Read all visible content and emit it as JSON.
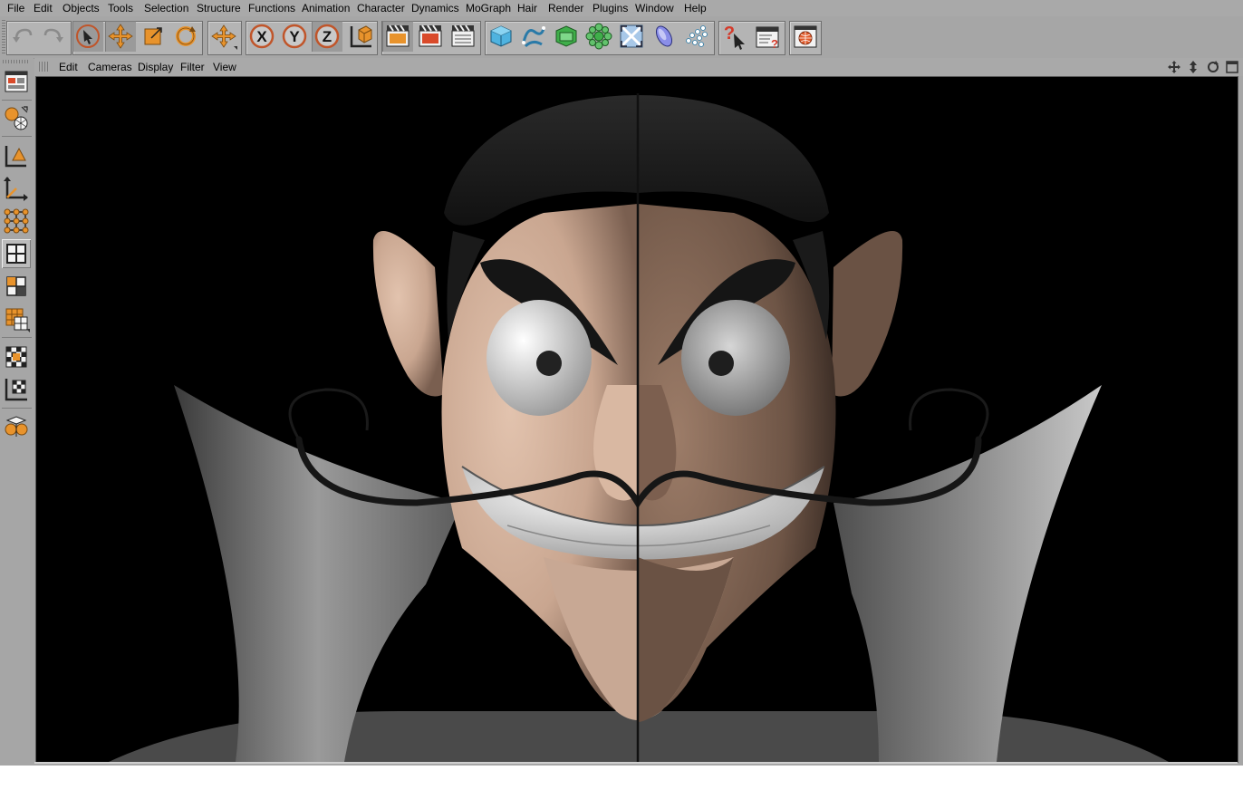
{
  "menu": [
    "File",
    "Edit",
    "Objects",
    "Tools",
    "Selection",
    "Structure",
    "Functions",
    "Animation",
    "Character",
    "Dynamics",
    "MoGraph",
    "Hair",
    "Render",
    "Plugins",
    "Window",
    "Help"
  ],
  "toolbar": {
    "buttons": [
      {
        "name": "undo-icon"
      },
      {
        "name": "redo-icon"
      },
      {
        "name": "live-selection-icon"
      },
      {
        "name": "move-icon"
      },
      {
        "name": "scale-icon"
      },
      {
        "name": "rotate-icon"
      },
      {
        "name": "recent-tool-icon"
      },
      {
        "name": "x-axis-icon",
        "glyph": "X"
      },
      {
        "name": "y-axis-icon",
        "glyph": "Y"
      },
      {
        "name": "z-axis-icon",
        "glyph": "Z"
      },
      {
        "name": "coordinate-system-icon"
      },
      {
        "name": "render-view-icon"
      },
      {
        "name": "render-picture-viewer-icon"
      },
      {
        "name": "render-settings-icon"
      },
      {
        "name": "cube-icon"
      },
      {
        "name": "spline-icon"
      },
      {
        "name": "nurbs-icon"
      },
      {
        "name": "array-icon"
      },
      {
        "name": "deformer-icon"
      },
      {
        "name": "scene-icon"
      },
      {
        "name": "particle-icon"
      },
      {
        "name": "help-icon"
      },
      {
        "name": "commander-icon"
      },
      {
        "name": "browser-icon"
      }
    ]
  },
  "left_palette": [
    {
      "name": "layout-icon"
    },
    {
      "name": "make-editable-icon"
    },
    {
      "name": "use-model-tool-icon"
    },
    {
      "name": "use-object-axis-icon"
    },
    {
      "name": "use-points-tool-icon"
    },
    {
      "name": "use-edges-tool-icon"
    },
    {
      "name": "use-polygons-tool-icon"
    },
    {
      "name": "use-uv-tool-icon"
    },
    {
      "name": "texture-tool-icon"
    },
    {
      "name": "workplane-icon"
    },
    {
      "name": "mirror-icon"
    }
  ],
  "viewport": {
    "menu": [
      "Edit",
      "Cameras",
      "Display",
      "Filter",
      "View"
    ],
    "corner_icons": [
      "pan-view-icon",
      "zoom-view-icon",
      "rotate-view-icon",
      "maximize-view-icon"
    ]
  },
  "colors": {
    "accent": "#e8932c",
    "skin": "#d6b49f",
    "hair": "#1e1e1e",
    "collar": "#8a8a8a"
  }
}
